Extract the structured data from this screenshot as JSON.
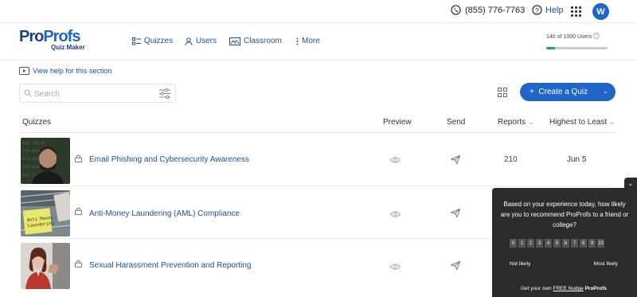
{
  "topbar": {
    "phone": "(855) 776-7763",
    "help": "Help",
    "avatar_initial": "W",
    "accent": "#1e66c8"
  },
  "logo": {
    "brand_a": "Pro",
    "brand_b": "Profs",
    "sub": "Quiz Maker"
  },
  "nav": {
    "quizzes": "Quizzes",
    "users": "Users",
    "classroom": "Classroom",
    "more": "More"
  },
  "usage": {
    "used": "140",
    "of_label": "of",
    "total_label": "1000 Users",
    "fraction": 0.14
  },
  "toolbar": {
    "view_help": "View help for this section",
    "search_placeholder": "Search",
    "create_label": "Create a Quiz"
  },
  "table": {
    "headers": {
      "quizzes": "Quizzes",
      "preview": "Preview",
      "send": "Send",
      "reports": "Reports",
      "sort": "Highest to Least"
    },
    "rows": [
      {
        "title": "Email Phishing and Cybersecurity Awareness",
        "reports": "210",
        "date": "Jun 5"
      },
      {
        "title": "Anti-Money Laundering (AML) Compliance",
        "reports": "",
        "date": ""
      },
      {
        "title": "Sexual Harassment Prevention and Reporting",
        "reports": "",
        "date": ""
      }
    ]
  },
  "nudge": {
    "question": "Based on your experience today, how likely are you to recommend ProProfs to a friend or college?",
    "scale": [
      "0",
      "1",
      "2",
      "3",
      "4",
      "5",
      "6",
      "7",
      "8",
      "9",
      "10"
    ],
    "not_likely": "Not likely",
    "most_likely": "Most likely",
    "footer_pre": "Get your own",
    "footer_link": "FREE Nudge",
    "footer_brand": "ProProfs"
  }
}
